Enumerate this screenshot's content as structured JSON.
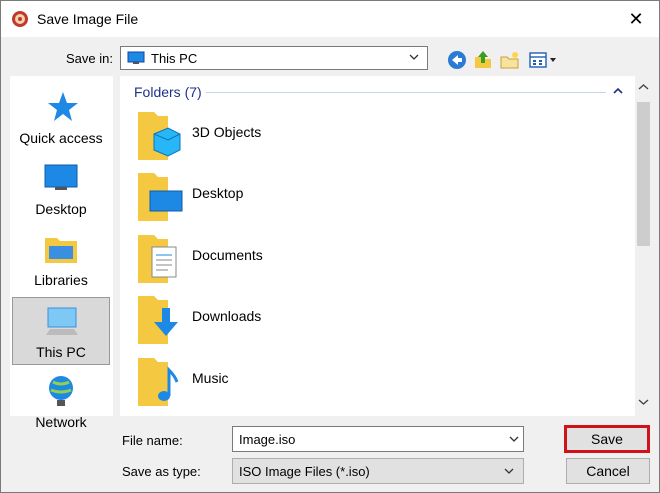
{
  "window": {
    "title": "Save Image File"
  },
  "toolbar": {
    "save_in_label": "Save in:",
    "save_in_value": "This PC",
    "icons": [
      "back-icon",
      "up-folder-icon",
      "new-folder-icon",
      "view-menu-icon"
    ]
  },
  "places": [
    {
      "label": "Quick access",
      "icon": "quick-access-star-icon"
    },
    {
      "label": "Desktop",
      "icon": "desktop-icon"
    },
    {
      "label": "Libraries",
      "icon": "libraries-icon"
    },
    {
      "label": "This PC",
      "icon": "this-pc-icon",
      "selected": true
    },
    {
      "label": "Network",
      "icon": "network-icon"
    }
  ],
  "file_list": {
    "group_header": "Folders (7)",
    "items": [
      {
        "label": "3D Objects",
        "icon": "3d-objects-folder-icon"
      },
      {
        "label": "Desktop",
        "icon": "desktop-folder-icon"
      },
      {
        "label": "Documents",
        "icon": "documents-folder-icon"
      },
      {
        "label": "Downloads",
        "icon": "downloads-folder-icon"
      },
      {
        "label": "Music",
        "icon": "music-folder-icon"
      }
    ]
  },
  "form": {
    "file_name_label": "File name:",
    "file_name_value": "Image.iso",
    "save_as_type_label": "Save as type:",
    "save_as_type_value": "ISO Image Files (*.iso)"
  },
  "buttons": {
    "save": "Save",
    "cancel": "Cancel"
  },
  "colors": {
    "accent_highlight": "#d0121a",
    "group_header": "#1e3287",
    "folder_yellow": "#f5c842"
  }
}
